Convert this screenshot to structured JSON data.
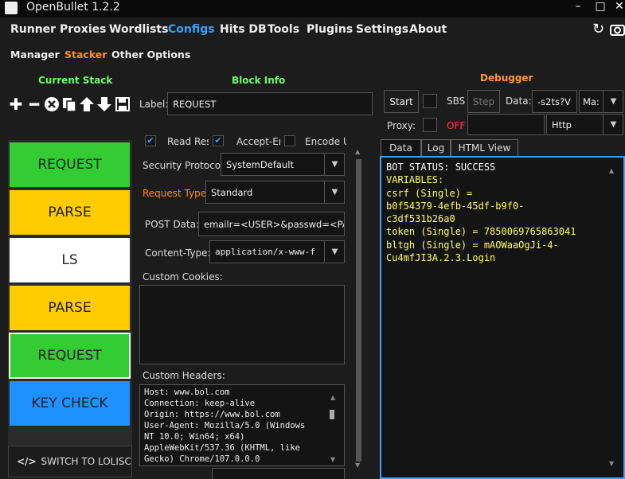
{
  "app": {
    "title": "OpenBullet 1.2.2",
    "minimize": "–",
    "maximize": "□"
  },
  "menu": [
    "Runner",
    "Proxies",
    "Wordlists",
    "Configs",
    "Hits DB",
    "Tools",
    "Plugins",
    "Settings",
    "About"
  ],
  "submenu": [
    "Manager",
    "Stacker",
    "Other Options"
  ],
  "stack": {
    "title": "Current Stack",
    "blocks": [
      {
        "label": "REQUEST",
        "color": "#33cc33"
      },
      {
        "label": "PARSE",
        "color": "#ffcc00"
      },
      {
        "label": "LS",
        "color": "#ffffff"
      },
      {
        "label": "PARSE",
        "color": "#ffcc00"
      },
      {
        "label": "REQUEST",
        "color": "#33cc33"
      },
      {
        "label": "KEY CHECK",
        "color": "#1e90ff"
      }
    ],
    "switch_label": "SWITCH TO LOLISCRI"
  },
  "block_info": {
    "title": "Block Info",
    "label_caption": "Label:",
    "label_value": "REQUEST",
    "checks": [
      "Read Res",
      "Accept-Er",
      "Encode U"
    ],
    "security_protocol_label": "Security Protocol:",
    "security_protocol_value": "SystemDefault",
    "request_type_label": "Request Type:",
    "request_type_value": "Standard",
    "post_data_label": "POST Data:",
    "post_data_value": "emailr=<USER>&passwd=<PASS",
    "content_type_label": "Content-Type:",
    "content_type_value": "application/x-www-f",
    "cookies_label": "Custom Cookies:",
    "headers_label": "Custom Headers:",
    "headers_lines": [
      "Host: www.bol.com",
      "Connection: keep-alive",
      "Origin: https://www.bol.com",
      "User-Agent: Mozilla/5.0 (Windows",
      "NT 10.0; Win64; x64)",
      "AppleWebKit/537.36 (KHTML, like",
      "Gecko) Chrome/107.0.0.0"
    ]
  },
  "debugger": {
    "title": "Debugger",
    "start": "Start",
    "sbs": "SBS",
    "step": "Step",
    "data_label": "Data:",
    "data_value": "-s2ts?V",
    "data_type": "Ma:",
    "proxy_label": "Proxy:",
    "off_label": "OFF",
    "proxy_type": "Http",
    "tabs": [
      "Data",
      "Log",
      "HTML View"
    ],
    "output_lines": [
      {
        "text": "BOT STATUS: SUCCESS",
        "color": "#ffffff"
      },
      {
        "text": "VARIABLES:",
        "color": "#ffff66"
      },
      {
        "text": "csrf (Single) =",
        "color": "#ffff66"
      },
      {
        "text": "b0f54379-4efb-45df-b9f0-",
        "color": "#ffff66"
      },
      {
        "text": "c3df531b26a0",
        "color": "#ffff66"
      },
      {
        "text": "token (Single) = 7850069765863041",
        "color": "#ffff66"
      },
      {
        "text": "bltgh (Single) = mAOWaaOgJi-4-",
        "color": "#ffff66"
      },
      {
        "text": "Cu4mfJI3A.2.3.Login",
        "color": "#ffff66"
      }
    ]
  },
  "colors": {
    "accent_blue": "#3ba0ff",
    "accent_orange": "#ff8c1a",
    "stack_green": "#66ff66",
    "debugger_orange": "#ff9933"
  }
}
